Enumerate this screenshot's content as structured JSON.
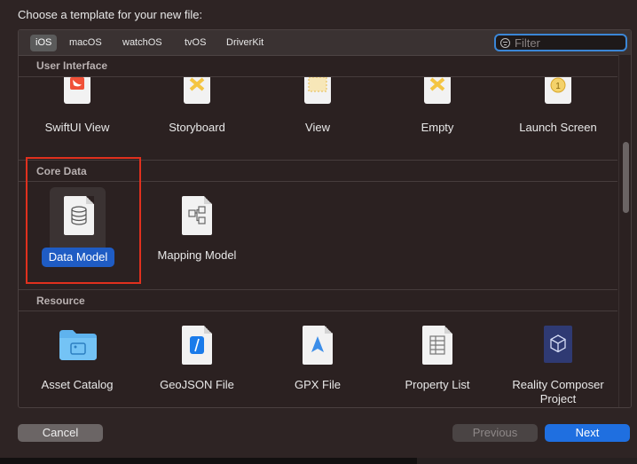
{
  "dialog": {
    "title": "Choose a template for your new file:"
  },
  "tabs": [
    {
      "label": "iOS",
      "selected": true
    },
    {
      "label": "macOS"
    },
    {
      "label": "watchOS"
    },
    {
      "label": "tvOS"
    },
    {
      "label": "DriverKit"
    }
  ],
  "filter": {
    "placeholder": "Filter",
    "icon": "filter-icon"
  },
  "sections": {
    "user_interface": {
      "title": "User Interface",
      "items": [
        {
          "label": "SwiftUI View",
          "icon": "swift-icon"
        },
        {
          "label": "Storyboard",
          "icon": "storyboard-icon"
        },
        {
          "label": "View",
          "icon": "view-icon"
        },
        {
          "label": "Empty",
          "icon": "empty-icon"
        },
        {
          "label": "Launch Screen",
          "icon": "launch-screen-icon"
        }
      ]
    },
    "core_data": {
      "title": "Core Data",
      "items": [
        {
          "label": "Data Model",
          "icon": "database-icon",
          "selected": true
        },
        {
          "label": "Mapping Model",
          "icon": "mapping-model-icon"
        }
      ]
    },
    "resource": {
      "title": "Resource",
      "items": [
        {
          "label": "Asset Catalog",
          "icon": "folder-icon"
        },
        {
          "label": "GeoJSON File",
          "icon": "geojson-icon"
        },
        {
          "label": "GPX File",
          "icon": "gpx-icon"
        },
        {
          "label": "Property List",
          "icon": "property-list-icon"
        },
        {
          "label": "Reality Composer Project",
          "icon": "reality-composer-icon"
        }
      ]
    }
  },
  "buttons": {
    "cancel": "Cancel",
    "previous": "Previous",
    "next": "Next"
  },
  "colors": {
    "accent": "#1f6fe0",
    "selection": "#1f5cc4",
    "highlight_box": "#e0301e"
  }
}
